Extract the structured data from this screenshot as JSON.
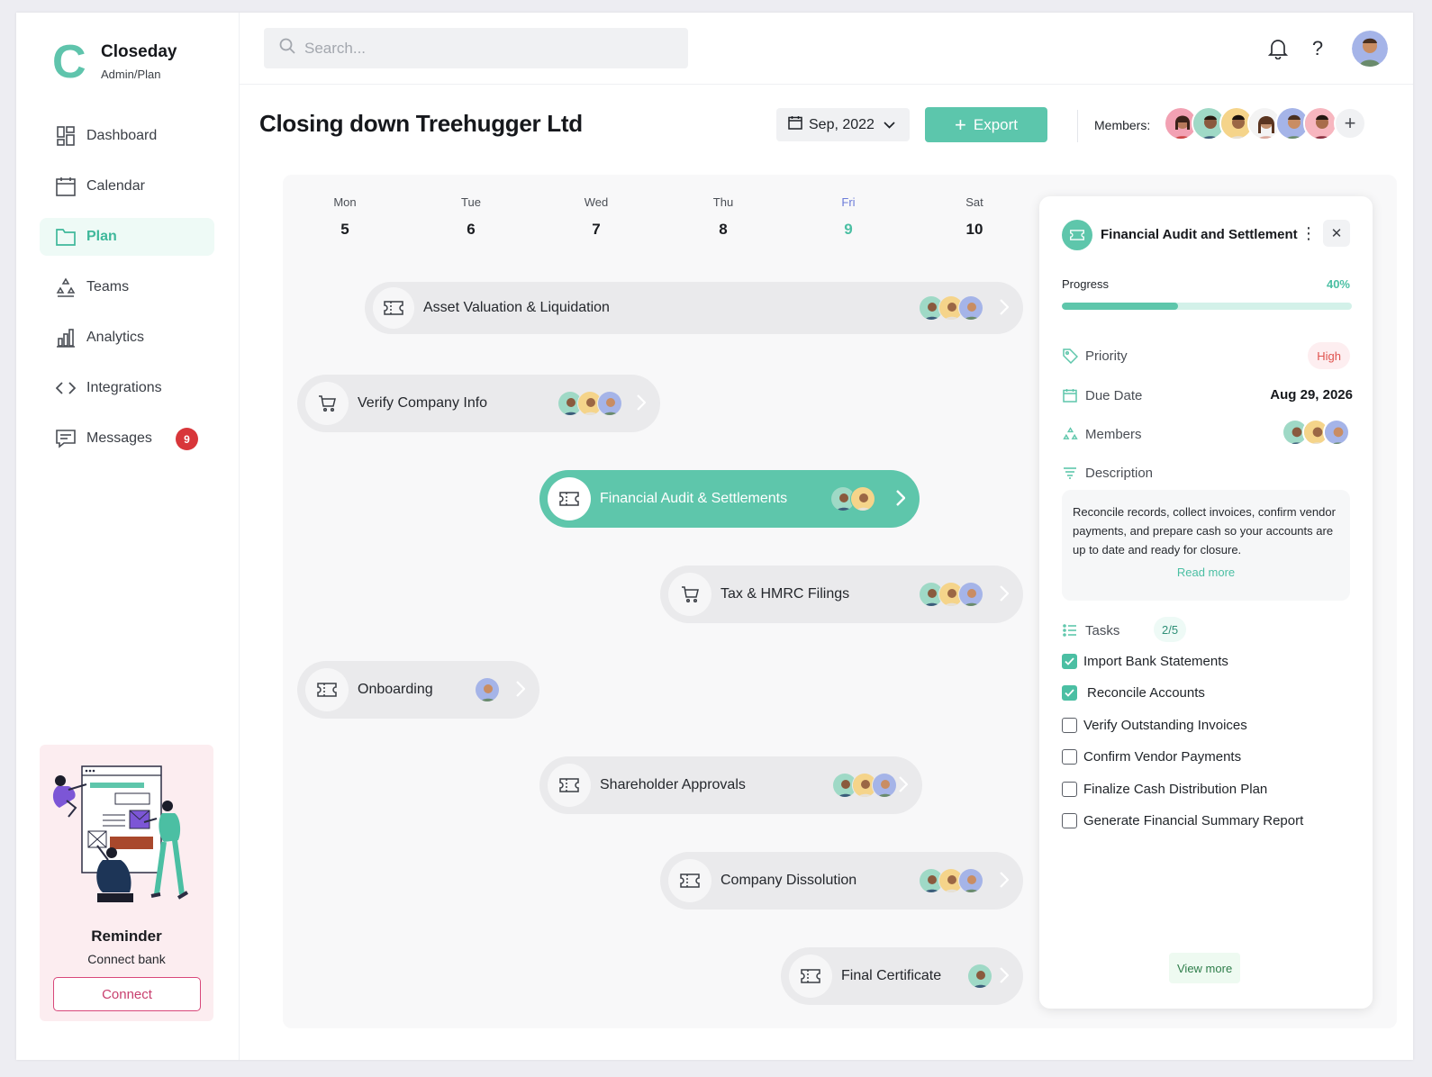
{
  "brand": {
    "logo_letter": "C",
    "name": "Closeday",
    "subtitle": "Admin/Plan"
  },
  "colors": {
    "accent": "#5ec6ab",
    "accent_dark": "#4bbfa3",
    "danger": "#d8363a",
    "reminder_bg": "#fcedf0"
  },
  "sidebar": {
    "items": [
      {
        "label": "Dashboard",
        "icon": "dashboard-icon"
      },
      {
        "label": "Calendar",
        "icon": "calendar-icon"
      },
      {
        "label": "Plan",
        "icon": "folder-icon",
        "active": true
      },
      {
        "label": "Teams",
        "icon": "teams-icon"
      },
      {
        "label": "Analytics",
        "icon": "analytics-icon"
      },
      {
        "label": "Integrations",
        "icon": "code-icon"
      },
      {
        "label": "Messages",
        "icon": "message-icon",
        "badge": "9"
      }
    ]
  },
  "reminder": {
    "title": "Reminder",
    "subtitle": "Connect bank",
    "button": "Connect"
  },
  "search": {
    "placeholder": "Search..."
  },
  "topbar": {
    "icons": [
      "bell-icon",
      "help-icon"
    ],
    "help_glyph": "?"
  },
  "header": {
    "title_prefix": "Closing down",
    "title_bold": "Treehugger Ltd",
    "date": "Sep, 2022",
    "export_label": "Export",
    "members_label": "Members:"
  },
  "calendar": {
    "days": [
      {
        "name": "Mon",
        "date": "5"
      },
      {
        "name": "Tue",
        "date": "6"
      },
      {
        "name": "Wed",
        "date": "7"
      },
      {
        "name": "Thu",
        "date": "8"
      },
      {
        "name": "Fri",
        "date": "9",
        "today": true
      },
      {
        "name": "Sat",
        "date": "10"
      }
    ],
    "tasks": [
      {
        "label": "Asset Valuation & Liquidation",
        "icon": "ticket-icon",
        "members": 3
      },
      {
        "label": "Verify Company Info",
        "icon": "cart-icon",
        "members": 3
      },
      {
        "label": "Financial Audit & Settlements",
        "icon": "ticket-icon",
        "members": 2,
        "active": true
      },
      {
        "label": "Tax & HMRC Filings",
        "icon": "cart-icon",
        "members": 3
      },
      {
        "label": "Onboarding",
        "icon": "ticket-icon",
        "members": 1
      },
      {
        "label": "Shareholder Approvals",
        "icon": "ticket-icon",
        "members": 3
      },
      {
        "label": "Company Dissolution",
        "icon": "ticket-icon",
        "members": 3
      },
      {
        "label": "Final Certificate",
        "icon": "ticket-icon",
        "members": 1
      }
    ]
  },
  "panel": {
    "title": "Financial Audit and Settlement",
    "kebab": "⋮",
    "close": "✕",
    "progress_label": "Progress",
    "progress_value": "40%",
    "progress_fraction": 0.4,
    "priority_label": "Priority",
    "priority_value": "High",
    "due_label": "Due Date",
    "due_value": "Aug 29, 2026",
    "members_label": "Members",
    "description_label": "Description",
    "description": "Reconcile records, collect invoices, confirm vendor payments, and prepare cash so your accounts are up to date and ready for closure.",
    "read_more": "Read more",
    "tasks_label": "Tasks",
    "tasks_count": "2/5",
    "tasks": [
      {
        "label": "Import Bank Statements",
        "checked": true
      },
      {
        "label": "Reconcile Accounts",
        "checked": true
      },
      {
        "label": "Verify Outstanding Invoices",
        "checked": false
      },
      {
        "label": "Confirm Vendor Payments",
        "checked": false
      },
      {
        "label": "Finalize Cash Distribution Plan",
        "checked": false
      },
      {
        "label": "Generate Financial Summary Report",
        "checked": false
      }
    ],
    "view_more": "View more"
  }
}
